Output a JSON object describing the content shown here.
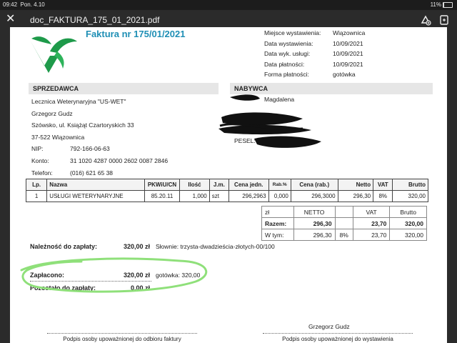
{
  "status": {
    "time": "09:42",
    "date": "Pon. 4.10",
    "battery": "11%"
  },
  "toolbar": {
    "close": "✕",
    "filename": "doc_FAKTURA_175_01_2021.pdf"
  },
  "invoice": {
    "title": "Faktura nr 175/01/2021",
    "meta": [
      {
        "label": "Miejsce wystawienia:",
        "value": "Wiązownica"
      },
      {
        "label": "Data wystawienia:",
        "value": "10/09/2021"
      },
      {
        "label": "Data wyk. usługi:",
        "value": "10/09/2021"
      },
      {
        "label": "Data płatności:",
        "value": "10/09/2021"
      },
      {
        "label": "Forma płatności:",
        "value": "gotówka"
      }
    ],
    "seller_header": "SPRZEDAWCA",
    "buyer_header": "NABYWCA",
    "seller": {
      "name": "Lecznica Weterynaryjna \"US-WET\"",
      "person": "Grzegorz Gudz",
      "street": "Szówsko, ul. Książąt Czartoryskich 33",
      "city": "37-522 Wiązownica",
      "nip_label": "NIP:",
      "nip": "792-166-06-63",
      "konto_label": "Konto:",
      "konto": "31 1020 4287 0000 2602 0087 2846",
      "tel_label": "Telefon:",
      "tel": "(016) 621 65 38"
    },
    "buyer": {
      "name": "Magdalena",
      "pesel_label": "PESEL:"
    },
    "items": {
      "headers": [
        "Lp.",
        "Nazwa",
        "PKWiU/CN",
        "Ilość",
        "J.m.",
        "Cena jedn.",
        "Rab.%",
        "Cena (rab.)",
        "Netto",
        "VAT",
        "Brutto"
      ],
      "rows": [
        [
          "1",
          "USŁUGI WETERYNARYJNE",
          "85.20.11",
          "1,000",
          "szt",
          "296,2963",
          "0,000",
          "296,3000",
          "296,30",
          "8%",
          "320,00"
        ]
      ]
    },
    "summary": {
      "head": [
        "zł",
        "NETTO",
        "",
        "VAT",
        "Brutto"
      ],
      "razem": [
        "Razem:",
        "296,30",
        "",
        "23,70",
        "320,00"
      ],
      "wtym": [
        "W tym:",
        "296,30",
        "8%",
        "23,70",
        "320,00"
      ]
    },
    "due_label": "Należność do zapłaty:",
    "due_value": "320,00 zł",
    "words": "Słownie: trzysta-dwadzieścia-złotych-00/100",
    "paid_label": "Zapłacono:",
    "paid_value": "320,00 zł",
    "paid_cash": "gotówka: 320,00",
    "rem_label": "Pozostało do zapłaty:",
    "rem_value": "0,00 zł",
    "signer": "Grzegorz Gudz",
    "sig_left": "Podpis osoby upoważnionej do odbioru faktury",
    "sig_right": "Podpis osoby upoważnionej do wystawienia"
  },
  "colors": {
    "title": "#1f8fb5",
    "logo": "#1e9a4a",
    "highlight": "#8fe07a"
  }
}
